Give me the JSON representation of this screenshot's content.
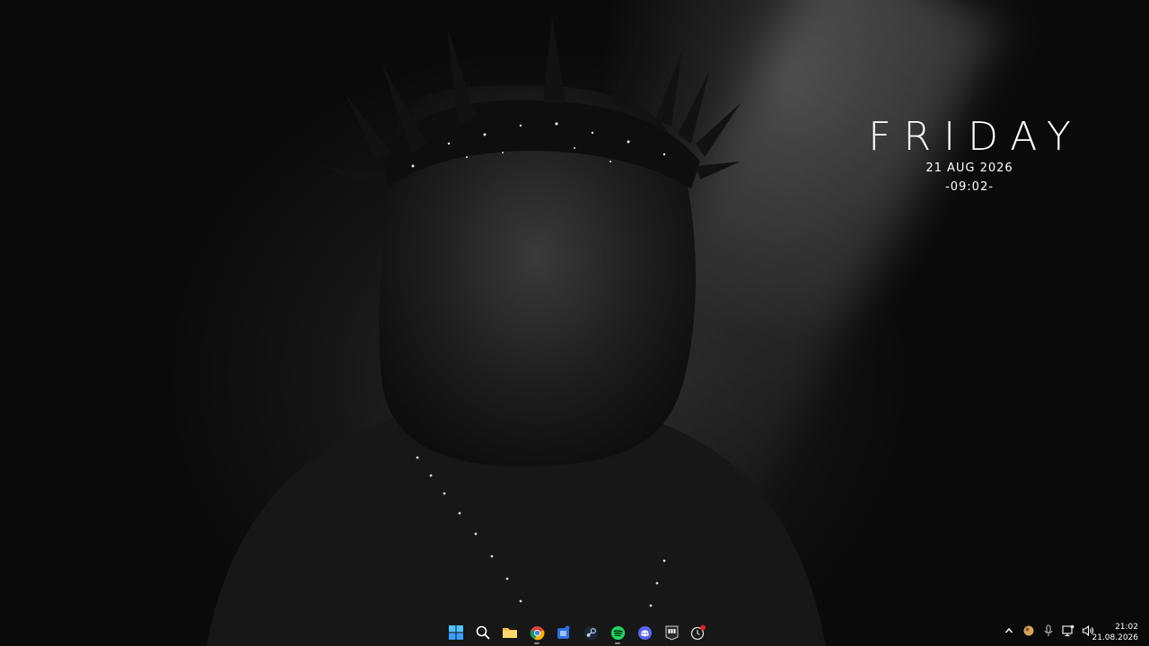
{
  "widget": {
    "day": "FRIDAY",
    "date": "21 AUG 2026",
    "time": "-09:02-"
  },
  "taskbar": {
    "apps": [
      {
        "name": "start-button",
        "icon": "windows-logo-icon"
      },
      {
        "name": "search-button",
        "icon": "search-icon"
      },
      {
        "name": "file-explorer-button",
        "icon": "folder-icon"
      },
      {
        "name": "chrome-button",
        "icon": "chrome-icon",
        "running": true
      },
      {
        "name": "app-button",
        "icon": "puzzle-icon"
      },
      {
        "name": "steam-button",
        "icon": "steam-icon"
      },
      {
        "name": "spotify-button",
        "icon": "spotify-icon",
        "running": true
      },
      {
        "name": "discord-button",
        "icon": "discord-icon"
      },
      {
        "name": "epic-games-button",
        "icon": "epic-games-icon"
      },
      {
        "name": "clock-app-button",
        "icon": "stopwatch-icon"
      }
    ],
    "clock": {
      "time": "21:02",
      "date": "21.08.2026"
    }
  },
  "colors": {
    "accent_blue": "#3aa0ff",
    "spotify_green": "#1ed760",
    "discord_blurple": "#5865f2",
    "notification_red": "#e02020",
    "folder_yellow": "#f2c14e"
  }
}
